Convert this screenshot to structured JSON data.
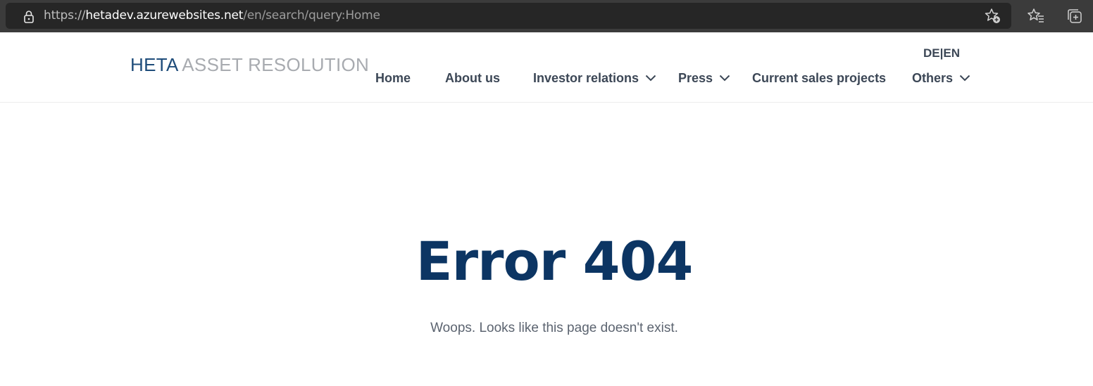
{
  "browser": {
    "url_protocol": "https://",
    "url_host": "hetadev.azurewebsites.net",
    "url_path": "/en/search/query:Home",
    "icons": [
      "lock-icon",
      "favorite-add-icon",
      "favorites-icon",
      "collections-icon"
    ]
  },
  "header": {
    "logo_primary": "HETA",
    "logo_secondary": "ASSET RESOLUTION",
    "lang": {
      "de": "DE",
      "separator": "|",
      "en": "EN"
    },
    "nav": {
      "home": "Home",
      "about": "About us",
      "investor": "Investor relations",
      "press": "Press",
      "sales": "Current sales projects",
      "others": "Others"
    }
  },
  "main": {
    "title": "Error 404",
    "message": "Woops. Looks like this page doesn't exist."
  },
  "colors": {
    "accent": "#0c3563",
    "logo_blue": "#1e4c7a",
    "logo_grey": "#a8abb0",
    "nav_text": "#3c4756",
    "body_text": "#5c6470"
  }
}
